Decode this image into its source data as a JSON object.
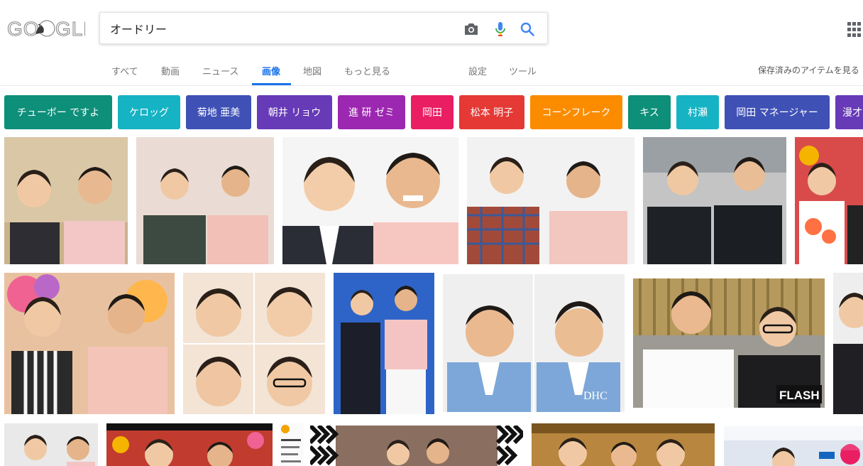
{
  "search": {
    "query": "オードリー",
    "placeholder": ""
  },
  "tabs": [
    {
      "label": "すべて"
    },
    {
      "label": "動画"
    },
    {
      "label": "ニュース"
    },
    {
      "label": "画像"
    },
    {
      "label": "地図"
    },
    {
      "label": "もっと見る"
    },
    {
      "label": "設定"
    },
    {
      "label": "ツール"
    }
  ],
  "active_tab": "画像",
  "saved_items_label": "保存済みのアイテムを見る",
  "chips": [
    {
      "label": "チューボー ですよ",
      "color": "#0e8f7a"
    },
    {
      "label": "ケロッグ",
      "color": "#16b3c4"
    },
    {
      "label": "菊地 亜美",
      "color": "#3f51b5"
    },
    {
      "label": "朝井 リョウ",
      "color": "#673ab7"
    },
    {
      "label": "進 研 ゼミ",
      "color": "#9c27b0"
    },
    {
      "label": "岡田",
      "color": "#e91e63"
    },
    {
      "label": "松本 明子",
      "color": "#e53935"
    },
    {
      "label": "コーンフレーク",
      "color": "#fb8c00"
    },
    {
      "label": "キス",
      "color": "#0e8f7a"
    },
    {
      "label": "村瀬",
      "color": "#16b3c4"
    },
    {
      "label": "岡田 マネージャー",
      "color": "#3f51b5"
    },
    {
      "label": "漫才",
      "color": "#673ab7"
    }
  ],
  "image_overlays": {
    "dhc": "DHC",
    "flash": "FLASH"
  }
}
